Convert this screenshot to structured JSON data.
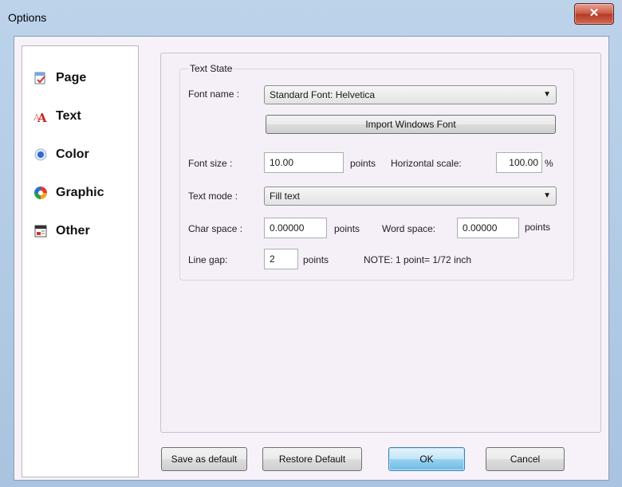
{
  "window": {
    "title": "Options",
    "close_glyph": "✕"
  },
  "sidebar": {
    "items": [
      {
        "label": "Page",
        "icon": "page-icon"
      },
      {
        "label": "Text",
        "icon": "text-icon"
      },
      {
        "label": "Color",
        "icon": "color-icon"
      },
      {
        "label": "Graphic",
        "icon": "graphic-icon"
      },
      {
        "label": "Other",
        "icon": "other-icon"
      }
    ]
  },
  "text_state": {
    "group_title": "Text State",
    "font_name_label": "Font name :",
    "font_name_value": "Standard Font: Helvetica",
    "import_button": "Import Windows Font",
    "font_size_label": "Font size :",
    "font_size_value": "10.00",
    "font_size_unit": "points",
    "hscale_label": "Horizontal scale:",
    "hscale_value": "100.00",
    "hscale_unit": "%",
    "text_mode_label": "Text mode :",
    "text_mode_value": "Fill text",
    "char_space_label": "Char space :",
    "char_space_value": "0.00000",
    "char_space_unit": "points",
    "word_space_label": "Word space:",
    "word_space_value": "0.00000",
    "word_space_unit": "points",
    "line_gap_label": "Line gap:",
    "line_gap_value": "2",
    "line_gap_unit": "points",
    "note": "NOTE: 1 point= 1/72 inch"
  },
  "footer": {
    "save_default": "Save as default",
    "restore_default": "Restore Default",
    "ok": "OK",
    "cancel": "Cancel"
  }
}
